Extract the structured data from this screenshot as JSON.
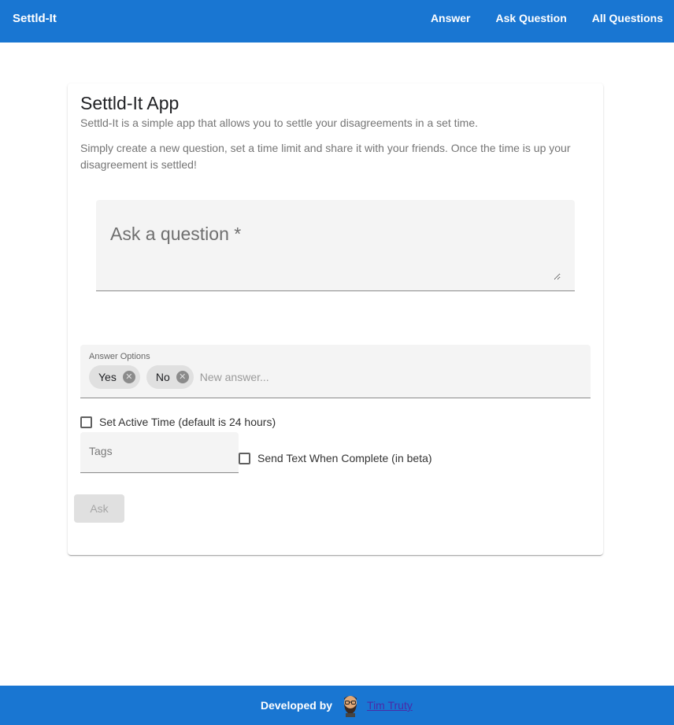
{
  "header": {
    "brand": "Settld-It",
    "nav": [
      "Answer",
      "Ask Question",
      "All Questions"
    ]
  },
  "card": {
    "title": "Settld-It App",
    "description1": "Settld-It is a simple app that allows you to settle your disagreements in a set time.",
    "description2": "Simply create a new question, set a time limit and share it with your friends. Once the time is up your disagreement is settled!"
  },
  "question": {
    "placeholder": "Ask a question *",
    "value": ""
  },
  "answers": {
    "label": "Answer Options",
    "chips": [
      "Yes",
      "No"
    ],
    "placeholder": "New answer..."
  },
  "options": {
    "active_time_label": "Set Active Time (default is 24 hours)",
    "active_time_checked": false,
    "tags_placeholder": "Tags",
    "send_text_label": "Send Text When Complete (in beta)",
    "send_text_checked": false
  },
  "ask_button": "Ask",
  "footer": {
    "developed_by": "Developed by",
    "developer_name": "Tim Truty"
  },
  "icons": {
    "chip_remove": "cancel-icon",
    "avatar": "bearded-man-avatar"
  },
  "colors": {
    "primary": "#1976d2",
    "field_bg": "#f4f4f4",
    "chip_bg": "#e0e0e0"
  }
}
